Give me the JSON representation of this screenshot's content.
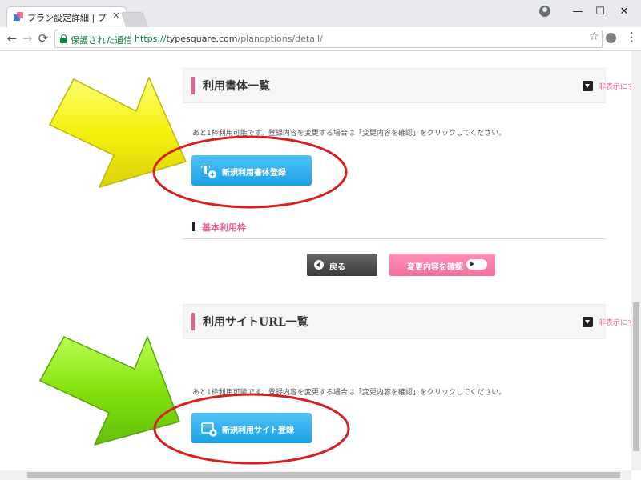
{
  "browser": {
    "tab_title": "プラン設定詳細 | プラン･オプ",
    "tab_close": "×",
    "window_controls": {
      "minimize": "—",
      "maximize": "☐",
      "close": "✕"
    },
    "nav": {
      "back": "←",
      "forward": "→",
      "reload": "⟳"
    },
    "address": {
      "secure_label": "保護された通信",
      "url_protocol": "https://",
      "url_host": "typesquare.com",
      "url_path": "/planoptions/detail/"
    },
    "star": "☆",
    "menu": "⋮"
  },
  "page": {
    "font_section": {
      "title": "利用書体一覧",
      "toggle_label": "非表示にする",
      "note": "あと1枠利用可能です。登録内容を変更する場合は「変更内容を確認」をクリックしてください。",
      "add_button_label": "新規利用書体登録",
      "subheading": "基本利用枠"
    },
    "actions": {
      "back_label": "戻る",
      "confirm_label": "変更内容を確認"
    },
    "site_section": {
      "title": "利用サイトURL一覧",
      "toggle_label": "非表示にする",
      "note": "あと1枠利用可能です。登録内容を変更する場合は「変更内容を確認」をクリックしてください。",
      "add_button_label": "新規利用サイト登録"
    }
  },
  "annotations": {
    "arrow_colors": {
      "top": "#f4f000",
      "bottom": "#7ee000"
    },
    "circle_color": "#d42020"
  }
}
